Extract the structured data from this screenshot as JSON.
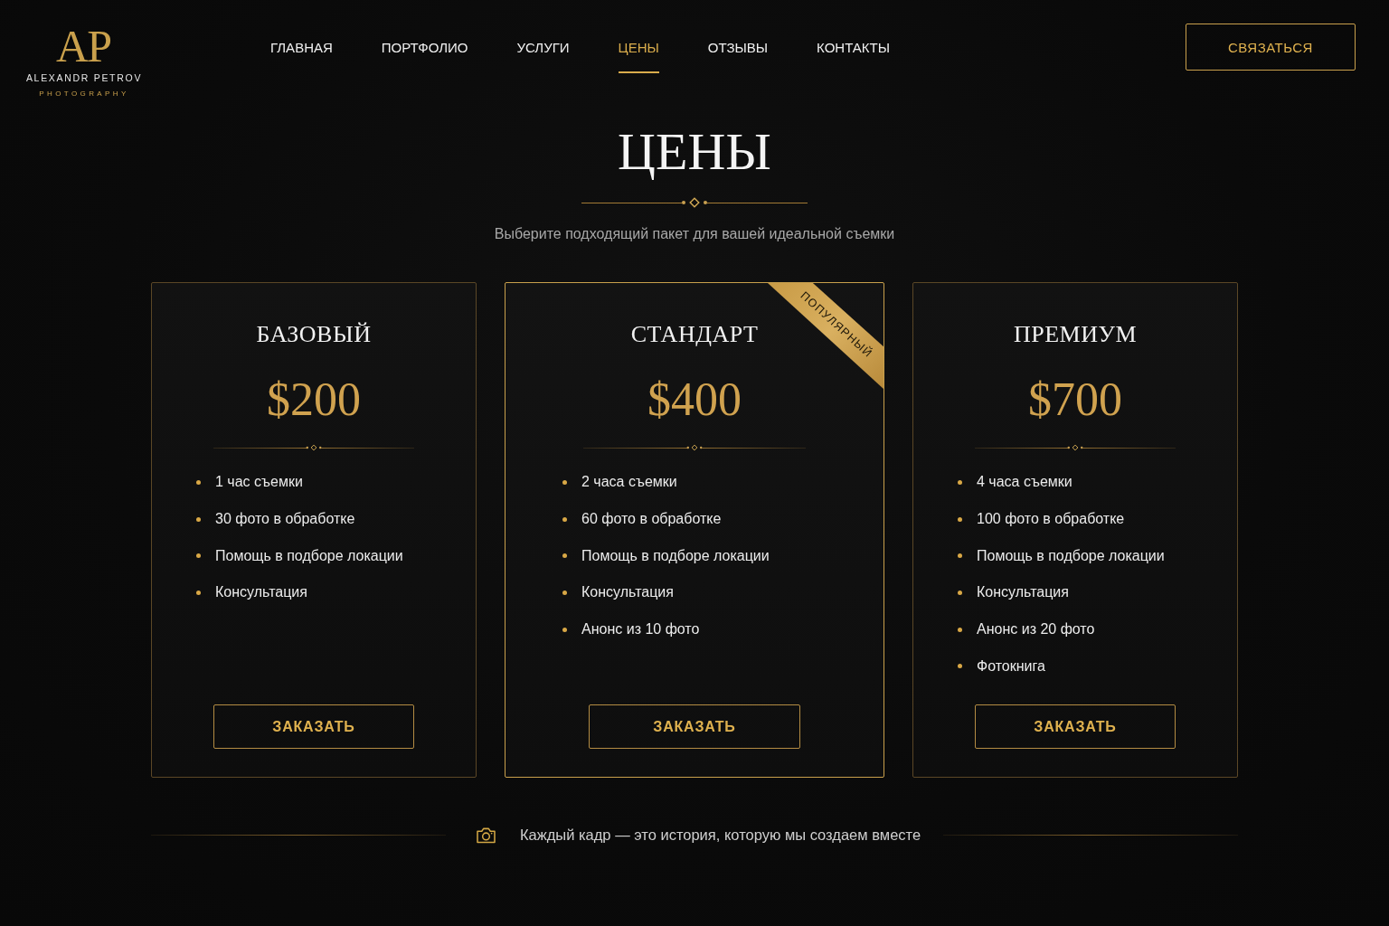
{
  "logo": {
    "monogram": "AP",
    "name": "ALEXANDR PETROV",
    "tagline": "PHOTOGRAPHY"
  },
  "nav": [
    {
      "label": "ГЛАВНАЯ",
      "selected": false
    },
    {
      "label": "ПОРТФОЛИО",
      "selected": false
    },
    {
      "label": "УСЛУГИ",
      "selected": false
    },
    {
      "label": "ЦЕНЫ",
      "selected": true
    },
    {
      "label": "ОТЗЫВЫ",
      "selected": false
    },
    {
      "label": "КОНТАКТЫ",
      "selected": false
    }
  ],
  "contact_button": "СВЯЗАТЬСЯ",
  "section": {
    "title": "ЦЕНЫ",
    "subtitle": "Выберите подходящий пакет для вашей идеальной съемки"
  },
  "plans": [
    {
      "name": "БАЗОВЫЙ",
      "price": "$200",
      "featured": false,
      "features": [
        "1 час съемки",
        "30 фото в обработке",
        "Помощь в подборе локации",
        "Консультация"
      ],
      "button": "ЗАКАЗАТЬ"
    },
    {
      "name": "СТАНДАРТ",
      "price": "$400",
      "featured": true,
      "ribbon": "ПОПУЛЯРНЫЙ",
      "features": [
        "2 часа съемки",
        "60 фото в обработке",
        "Помощь в подборе локации",
        "Консультация",
        "Анонс из 10 фото"
      ],
      "button": "ЗАКАЗАТЬ"
    },
    {
      "name": "ПРЕМИУМ",
      "price": "$700",
      "featured": false,
      "features": [
        "4 часа съемки",
        "100 фото в обработке",
        "Помощь в подборе локации",
        "Консультация",
        "Анонс из 20 фото",
        "Фотокнига"
      ],
      "button": "ЗАКАЗАТЬ"
    }
  ],
  "footer": {
    "quote": "Каждый кадр — это история, которую мы создаем вместе"
  }
}
